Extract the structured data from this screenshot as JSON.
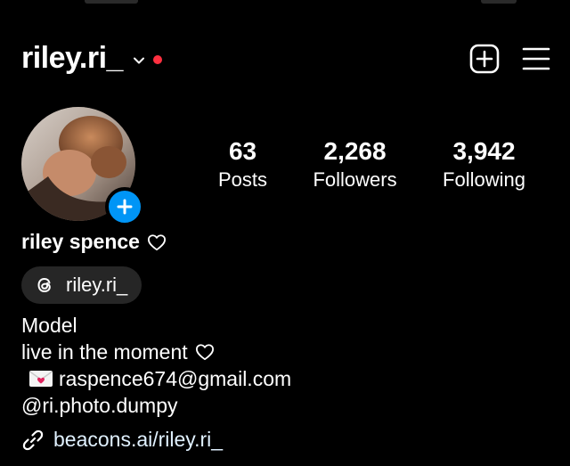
{
  "header": {
    "username": "riley.ri_",
    "notification_dot_color": "#ff3040",
    "new_post_icon": "plus-square-icon",
    "menu_icon": "hamburger-menu-icon"
  },
  "profile": {
    "avatar_badge_icon": "plus-icon",
    "stats": [
      {
        "value": "63",
        "label": "Posts"
      },
      {
        "value": "2,268",
        "label": "Followers"
      },
      {
        "value": "3,942",
        "label": "Following"
      }
    ],
    "full_name": "riley spence",
    "threads_handle": "riley.ri_",
    "bio": {
      "line1": "Model",
      "line2": "live in the moment",
      "email": "raspence674@gmail.com",
      "mention": "@ri.photo.dumpy"
    },
    "link": "beacons.ai/riley.ri_"
  },
  "colors": {
    "background": "#000000",
    "accent_blue": "#0095f6",
    "pill_bg": "#262626"
  }
}
